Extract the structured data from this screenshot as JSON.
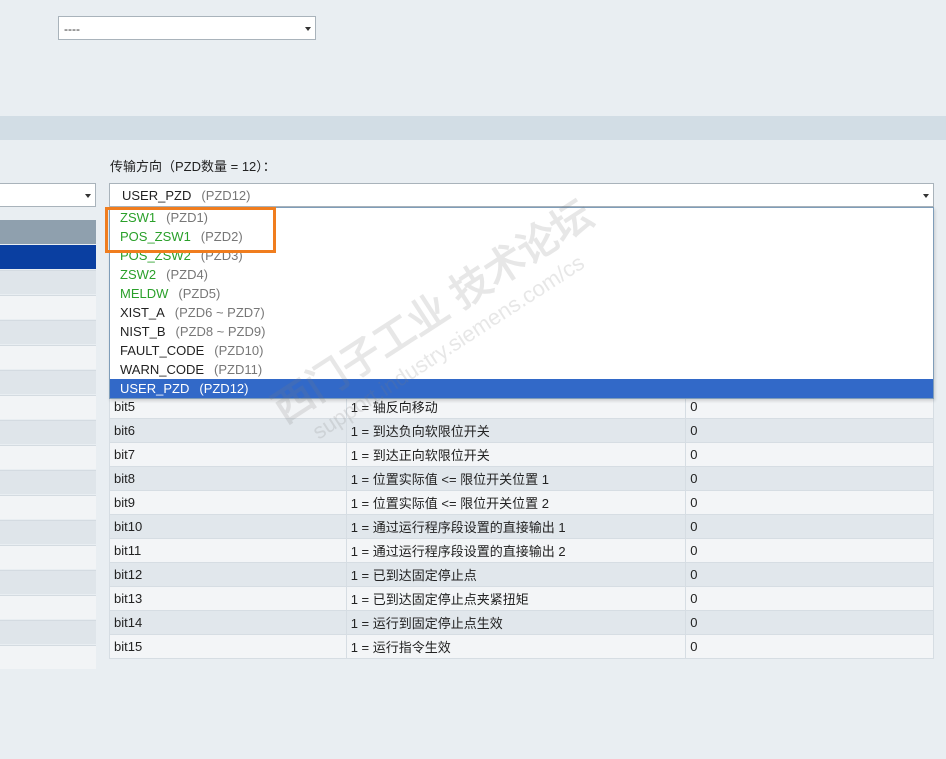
{
  "top_select": {
    "value": "----"
  },
  "direction_label": "传输方向（PZD数量 = 12）：",
  "main_select": {
    "name": "USER_PZD",
    "pzd": "(PZD12)"
  },
  "dropdown_options": [
    {
      "name": "ZSW1",
      "pzd": "(PZD1)",
      "color": "#2aa02a"
    },
    {
      "name": "POS_ZSW1",
      "pzd": "(PZD2)",
      "color": "#2aa02a"
    },
    {
      "name": "POS_ZSW2",
      "pzd": "(PZD3)",
      "color": "#2aa02a"
    },
    {
      "name": "ZSW2",
      "pzd": "(PZD4)",
      "color": "#2aa02a"
    },
    {
      "name": "MELDW",
      "pzd": "(PZD5)",
      "color": "#2aa02a"
    },
    {
      "name": "XIST_A",
      "pzd": "(PZD6 ~ PZD7)",
      "color": "#222222"
    },
    {
      "name": "NIST_B",
      "pzd": "(PZD8 ~ PZD9)",
      "color": "#222222"
    },
    {
      "name": "FAULT_CODE",
      "pzd": "(PZD10)",
      "color": "#222222"
    },
    {
      "name": "WARN_CODE",
      "pzd": "(PZD11)",
      "color": "#222222"
    },
    {
      "name": "USER_PZD",
      "pzd": "(PZD12)",
      "color": "#ffffff",
      "selected": true
    }
  ],
  "table_rows": [
    {
      "bit": "bit5",
      "desc": "1 = 轴反向移动",
      "value": "0"
    },
    {
      "bit": "bit6",
      "desc": "1 = 到达负向软限位开关",
      "value": "0"
    },
    {
      "bit": "bit7",
      "desc": "1 = 到达正向软限位开关",
      "value": "0"
    },
    {
      "bit": "bit8",
      "desc": "1 = 位置实际值 <= 限位开关位置 1",
      "value": "0"
    },
    {
      "bit": "bit9",
      "desc": "1 = 位置实际值 <= 限位开关位置 2",
      "value": "0"
    },
    {
      "bit": "bit10",
      "desc": "1 = 通过运行程序段设置的直接输出 1",
      "value": "0"
    },
    {
      "bit": "bit11",
      "desc": "1 = 通过运行程序段设置的直接输出 2",
      "value": "0"
    },
    {
      "bit": "bit12",
      "desc": "1 = 已到达固定停止点",
      "value": "0"
    },
    {
      "bit": "bit13",
      "desc": "1 = 已到达固定停止点夹紧扭矩",
      "value": "0"
    },
    {
      "bit": "bit14",
      "desc": "1 = 运行到固定停止点生效",
      "value": "0"
    },
    {
      "bit": "bit15",
      "desc": "1 = 运行指令生效",
      "value": "0"
    }
  ],
  "watermark": {
    "line1": "西门子工业 技术论坛",
    "line2": "support.industry.siemens.com/cs"
  },
  "colors": {
    "highlight": "#f07d1e",
    "selected_option": "#3269c8",
    "green_text": "#2aa02a"
  }
}
